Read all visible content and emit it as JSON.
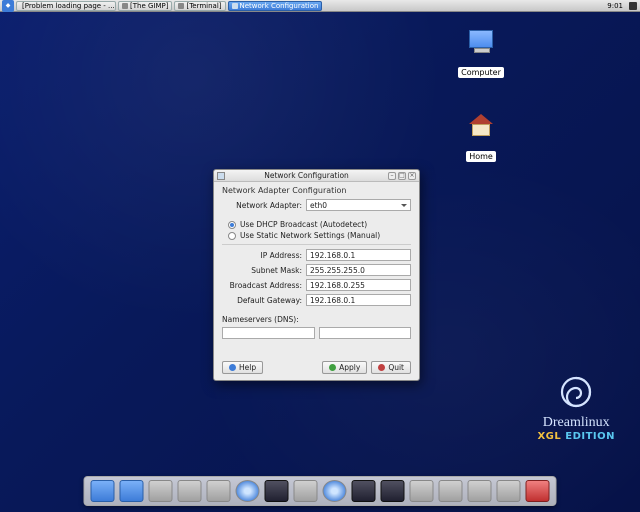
{
  "taskbar": {
    "buttons": [
      {
        "label": "[Problem loading page - ..."
      },
      {
        "label": "[The GIMP]"
      },
      {
        "label": "[Terminal]"
      },
      {
        "label": "Network Configuration",
        "active": true
      }
    ],
    "clock": "9:01"
  },
  "desktop": {
    "computer_label": "Computer",
    "home_label": "Home"
  },
  "window": {
    "title": "Network Configuration",
    "subhead": "Network Adapter Configuration",
    "adapter_label": "Network Adapter:",
    "adapter_value": "eth0",
    "radio_dhcp": "Use DHCP Broadcast (Autodetect)",
    "radio_static": "Use Static Network Settings (Manual)",
    "fields": {
      "ip_label": "IP Address:",
      "ip_value": "192.168.0.1",
      "mask_label": "Subnet Mask:",
      "mask_value": "255.255.255.0",
      "bcast_label": "Broadcast Address:",
      "bcast_value": "192.168.0.255",
      "gw_label": "Default Gateway:",
      "gw_value": "192.168.0.1"
    },
    "ns_label": "Nameservers (DNS):",
    "buttons": {
      "help": "Help",
      "apply": "Apply",
      "quit": "Quit"
    }
  },
  "brand": {
    "name": "Dreamlinux",
    "edition_pre": "XGL",
    "edition_post": "EDITION"
  }
}
